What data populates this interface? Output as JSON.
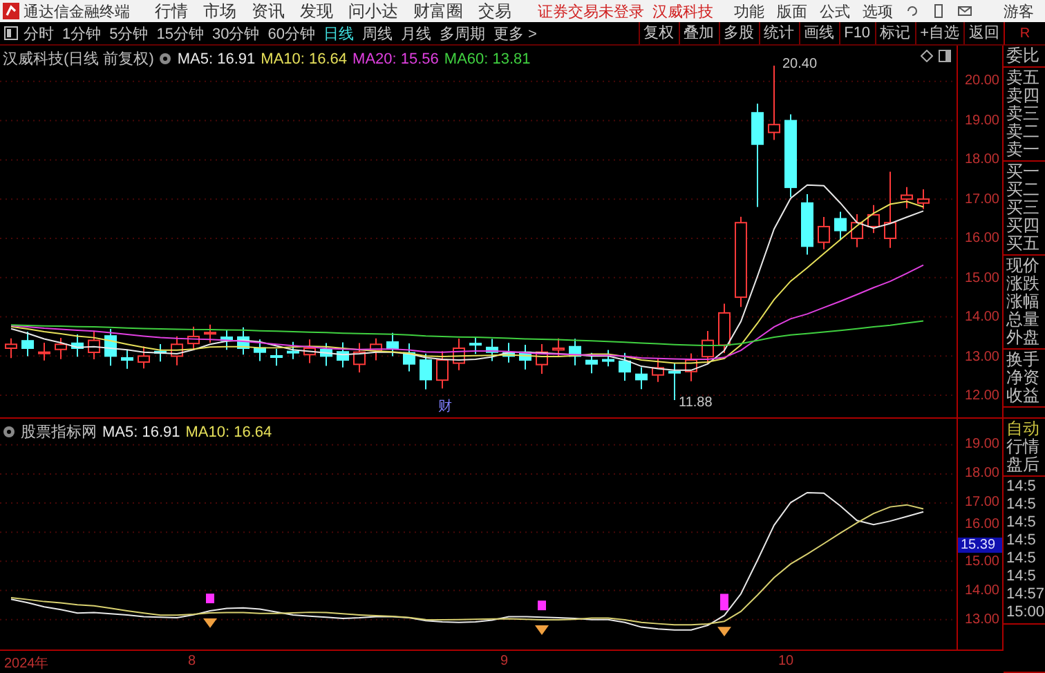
{
  "app": {
    "title": "通达信金融终端",
    "menu": [
      "行情",
      "市场",
      "资讯",
      "发现",
      "问小达",
      "财富圈",
      "交易"
    ],
    "login_notice": "证券交易未登录",
    "stock_link": "汉威科技",
    "tools": [
      "功能",
      "版面",
      "公式",
      "选项"
    ],
    "user": "游客"
  },
  "toolbar": {
    "periods": [
      {
        "label": "分时",
        "selected": false
      },
      {
        "label": "1分钟",
        "selected": false
      },
      {
        "label": "5分钟",
        "selected": false
      },
      {
        "label": "15分钟",
        "selected": false
      },
      {
        "label": "30分钟",
        "selected": false
      },
      {
        "label": "60分钟",
        "selected": false
      },
      {
        "label": "日线",
        "selected": true
      },
      {
        "label": "周线",
        "selected": false
      },
      {
        "label": "月线",
        "selected": false
      },
      {
        "label": "多周期",
        "selected": false
      },
      {
        "label": "更多 >",
        "selected": false
      }
    ],
    "actions": [
      "复权",
      "叠加",
      "多股",
      "统计",
      "画线",
      "F10",
      "标记",
      "+自选",
      "返回"
    ],
    "side_label": "R"
  },
  "main_chart": {
    "title": "汉威科技(日线 前复权)",
    "indicators": [
      {
        "label": "MA5: 16.91",
        "color": "#e8e8e8"
      },
      {
        "label": "MA10: 16.64",
        "color": "#e6e05a"
      },
      {
        "label": "MA20: 15.56",
        "color": "#e040e0"
      },
      {
        "label": "MA60: 13.81",
        "color": "#40d040"
      }
    ],
    "y_axis": [
      "20.00",
      "19.00",
      "18.00",
      "17.00",
      "16.00",
      "15.00",
      "14.00",
      "13.00",
      "12.00"
    ],
    "high_label": "20.40",
    "low_label": "11.88",
    "event_tag": "财"
  },
  "indicator_chart": {
    "title": "股票指标网",
    "indicators": [
      {
        "label": "MA5: 16.91",
        "color": "#e8e8e8"
      },
      {
        "label": "MA10: 16.64",
        "color": "#e6e05a"
      }
    ],
    "y_axis": [
      "19.00",
      "18.00",
      "17.00",
      "16.00",
      "15.00",
      "14.00",
      "13.00"
    ],
    "current_value": "15.39"
  },
  "x_axis": [
    "2024年",
    "8",
    "9",
    "10"
  ],
  "side_panel": {
    "quote_groups": [
      [
        "委比"
      ],
      [
        "卖五",
        "卖四",
        "卖三",
        "卖二",
        "卖一"
      ],
      [
        "买一",
        "买二",
        "买三",
        "买四",
        "买五"
      ],
      [
        "现价",
        "涨跌",
        "涨幅",
        "总量",
        "外盘"
      ],
      [
        "换手",
        "净资",
        "收益"
      ]
    ],
    "status": [
      {
        "label": "自动",
        "kind": "mode"
      },
      {
        "label": "行情",
        "kind": "plain"
      },
      {
        "label": "盘后",
        "kind": "plain"
      }
    ],
    "times": [
      "14:5",
      "14:5",
      "14:5",
      "14:5",
      "14:5",
      "14:5",
      "14:57",
      "15:00"
    ]
  }
}
